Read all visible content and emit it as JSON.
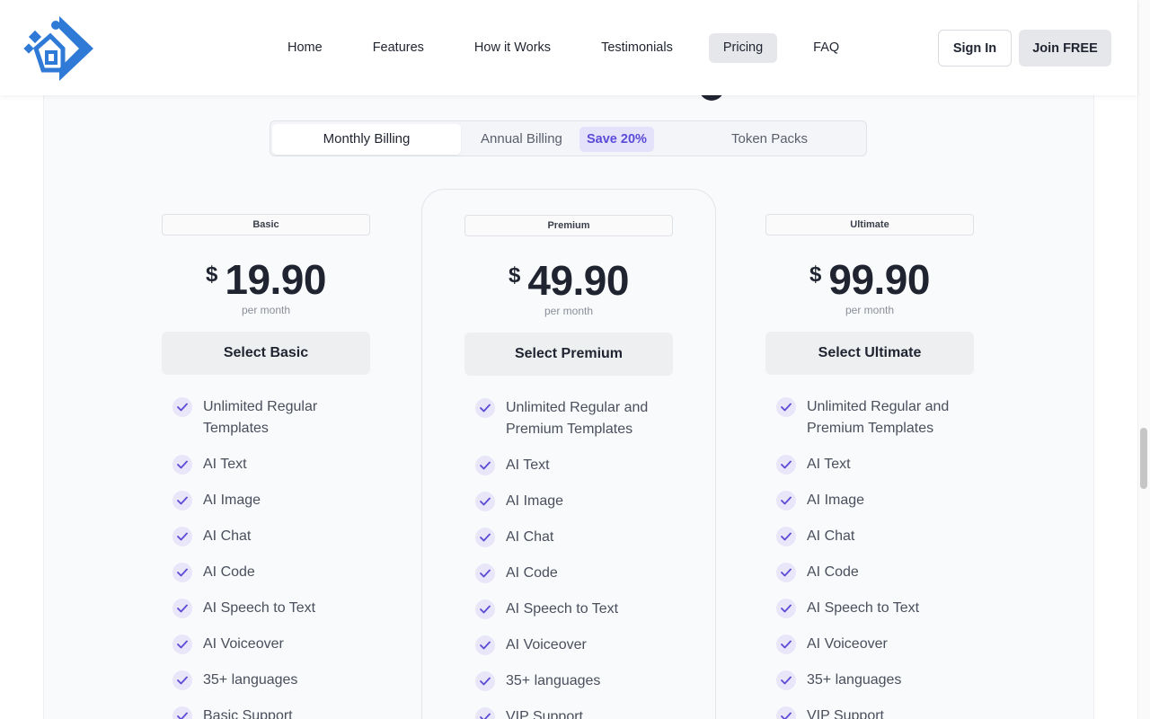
{
  "header": {
    "nav": [
      {
        "label": "Home",
        "active": false
      },
      {
        "label": "Features",
        "active": false
      },
      {
        "label": "How it Works",
        "active": false
      },
      {
        "label": "Testimonials",
        "active": false
      },
      {
        "label": "Pricing",
        "active": true
      },
      {
        "label": "FAQ",
        "active": false
      }
    ],
    "sign_in_label": "Sign In",
    "join_label": "Join FREE"
  },
  "billing_toggle": {
    "monthly": "Monthly Billing",
    "annual": "Annual Billing",
    "save_badge": "Save 20%",
    "tokens": "Token Packs",
    "selected": "Monthly Billing"
  },
  "plans": [
    {
      "badge": "Basic",
      "currency": "$",
      "price": "19.90",
      "period": "per month",
      "button": "Select Basic",
      "features": [
        "Unlimited Regular Templates",
        "AI Text",
        "AI Image",
        "AI Chat",
        "AI Code",
        "AI Speech to Text",
        "AI Voiceover",
        "35+ languages",
        "Basic Support"
      ]
    },
    {
      "badge": "Premium",
      "currency": "$",
      "price": "49.90",
      "period": "per month",
      "button": "Select Premium",
      "features": [
        "Unlimited Regular and Premium Templates",
        "AI Text",
        "AI Image",
        "AI Chat",
        "AI Code",
        "AI Speech to Text",
        "AI Voiceover",
        "35+ languages",
        "VIP Support"
      ]
    },
    {
      "badge": "Ultimate",
      "currency": "$",
      "price": "99.90",
      "period": "per month",
      "button": "Select Ultimate",
      "features": [
        "Unlimited Regular and Premium Templates",
        "AI Text",
        "AI Image",
        "AI Chat",
        "AI Code",
        "AI Speech to Text",
        "AI Voiceover",
        "35+ languages",
        "VIP Support"
      ]
    }
  ],
  "colors": {
    "logo_blue": "#2f7ad6",
    "accent_purple": "#5b4bd6",
    "check_bg": "#e8e6f8"
  }
}
